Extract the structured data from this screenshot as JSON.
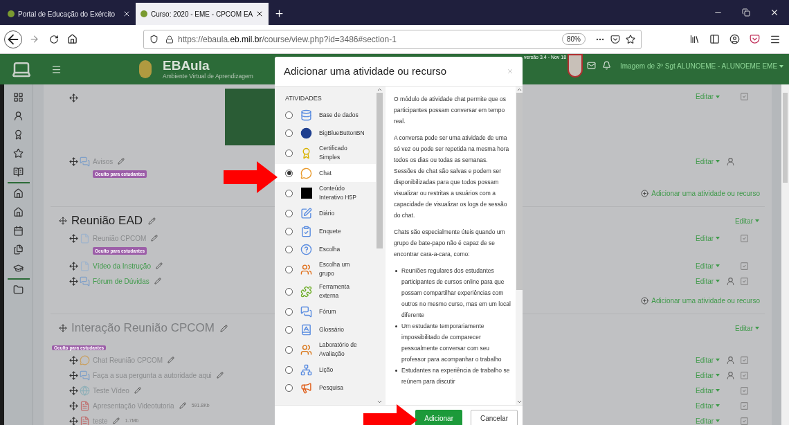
{
  "browser": {
    "tabs": [
      {
        "title": "Portal de Educação do Exército",
        "selected": false
      },
      {
        "title": "Curso: 2020 - EME - CPCOM EA",
        "selected": true
      }
    ],
    "url": "https://ebaula.**eb.mil.br**/course/view.php?id=3486#section-1",
    "zoom": "80%"
  },
  "header": {
    "brand": "EBAula",
    "subtitle": "Ambiente Virtual de Aprendizagem",
    "version": "versão 3.4 - Nov 18",
    "user": "Imagem de 3º Sgt ALUNOEME - ALUNOEME EME"
  },
  "sections": [
    {
      "items": [
        {
          "kind": "image",
          "edit": "Editar",
          "group": false,
          "completion": true
        },
        {
          "kind": "forum",
          "name": "Avisos",
          "hidden": true,
          "badge": "Oculto para estudantes",
          "edit": "Editar",
          "group": true,
          "completion": false
        }
      ],
      "add": "Adicionar uma atividade ou recurso"
    },
    {
      "title": "Reunião EAD",
      "hidden": false,
      "edit": "Editar",
      "items": [
        {
          "kind": "page",
          "name": "Reunião CPCOM",
          "hidden": true,
          "badge": "Oculto para estudantes",
          "edit": "Editar",
          "group": false,
          "completion": true
        },
        {
          "kind": "page",
          "name": "Vídeo da Instrução",
          "hidden": false,
          "edit": "Editar",
          "group": false,
          "completion": true
        },
        {
          "kind": "forum",
          "name": "Fórum de Dúvidas",
          "hidden": false,
          "edit": "Editar",
          "group": true,
          "completion": true
        }
      ],
      "add": "Adicionar uma atividade ou recurso"
    },
    {
      "title": "Interação Reunião CPCOM",
      "hidden": true,
      "badge": "Oculto para estudantes",
      "edit": "Editar",
      "items": [
        {
          "kind": "chat",
          "name": "Chat Reunião CPCOM",
          "hidden": true,
          "edit": "Editar",
          "group": true,
          "completion": true
        },
        {
          "kind": "forum",
          "name": "Faça a sua pergunta a autoridade aqui",
          "hidden": true,
          "edit": "Editar",
          "group": true,
          "completion": true
        },
        {
          "kind": "url",
          "name": "Teste Vídeo",
          "hidden": true,
          "edit": "Editar",
          "group": false,
          "completion": true
        },
        {
          "kind": "pdf",
          "name": "Apresentação Videotutoria",
          "hidden": true,
          "size": "591.8Kb",
          "edit": "Editar",
          "group": false,
          "completion": true
        },
        {
          "kind": "pdf",
          "name": "teste",
          "hidden": true,
          "size": "1.7Mb",
          "edit": "Editar",
          "group": false,
          "completion": true
        }
      ]
    }
  ],
  "modal": {
    "title": "Adicionar uma atividade ou recurso",
    "group": "ATIVIDADES",
    "options": [
      {
        "label": "Base de dados",
        "kind": "database",
        "selected": false
      },
      {
        "label": "BigBlueButtonBN",
        "kind": "bbb",
        "selected": false
      },
      {
        "label": "Certificado Simples",
        "kind": "certificate",
        "selected": false
      },
      {
        "label": "Chat",
        "kind": "chat",
        "selected": true
      },
      {
        "label": "Conteúdo Interativo H5P",
        "kind": "h5p",
        "selected": false
      },
      {
        "label": "Diário",
        "kind": "journal",
        "selected": false
      },
      {
        "label": "Enquete",
        "kind": "survey",
        "selected": false
      },
      {
        "label": "Escolha",
        "kind": "choice",
        "selected": false
      },
      {
        "label": "Escolha um grupo",
        "kind": "group",
        "selected": false
      },
      {
        "label": "Ferramenta externa",
        "kind": "tool",
        "selected": false
      },
      {
        "label": "Fórum",
        "kind": "forum",
        "selected": false
      },
      {
        "label": "Glossário",
        "kind": "glossary",
        "selected": false
      },
      {
        "label": "Laboratório de Avaliação",
        "kind": "workshop",
        "selected": false
      },
      {
        "label": "Lição",
        "kind": "lesson",
        "selected": false
      },
      {
        "label": "Pesquisa",
        "kind": "feedback",
        "selected": false
      }
    ],
    "description": [
      {
        "kind": "p",
        "text": "O módulo de atividade chat permite que os participantes possam conversar em tempo real."
      },
      {
        "kind": "p",
        "text": "A conversa pode ser uma atividade de uma só vez ou pode ser repetida na mesma hora todos os dias ou todas as semanas. Sessões de chat são salvas e podem ser disponibilizadas para que todos possam visualizar ou restritas a usuários com a capacidade de visualizar os logs de sessão do chat."
      },
      {
        "kind": "p",
        "text": "Chats são especialmente úteis quando um grupo de bate-papo não é capaz de se encontrar cara-a-cara, como:"
      },
      {
        "kind": "ul",
        "items": [
          "Reuniões regulares dos estudantes participantes de cursos online para que possam compartilhar experiências com outros no mesmo curso, mas em um local diferente",
          "Um estudante temporariamente impossibilitado de comparecer pessoalmente conversar com seu professor para acompanhar o trabalho",
          "Estudantes na experiência de trabalho se reúnem para discutir"
        ]
      }
    ],
    "buttons": [
      {
        "label": "Adicionar",
        "kind": "primary"
      },
      {
        "label": "Cancelar",
        "kind": "secondary"
      }
    ]
  }
}
